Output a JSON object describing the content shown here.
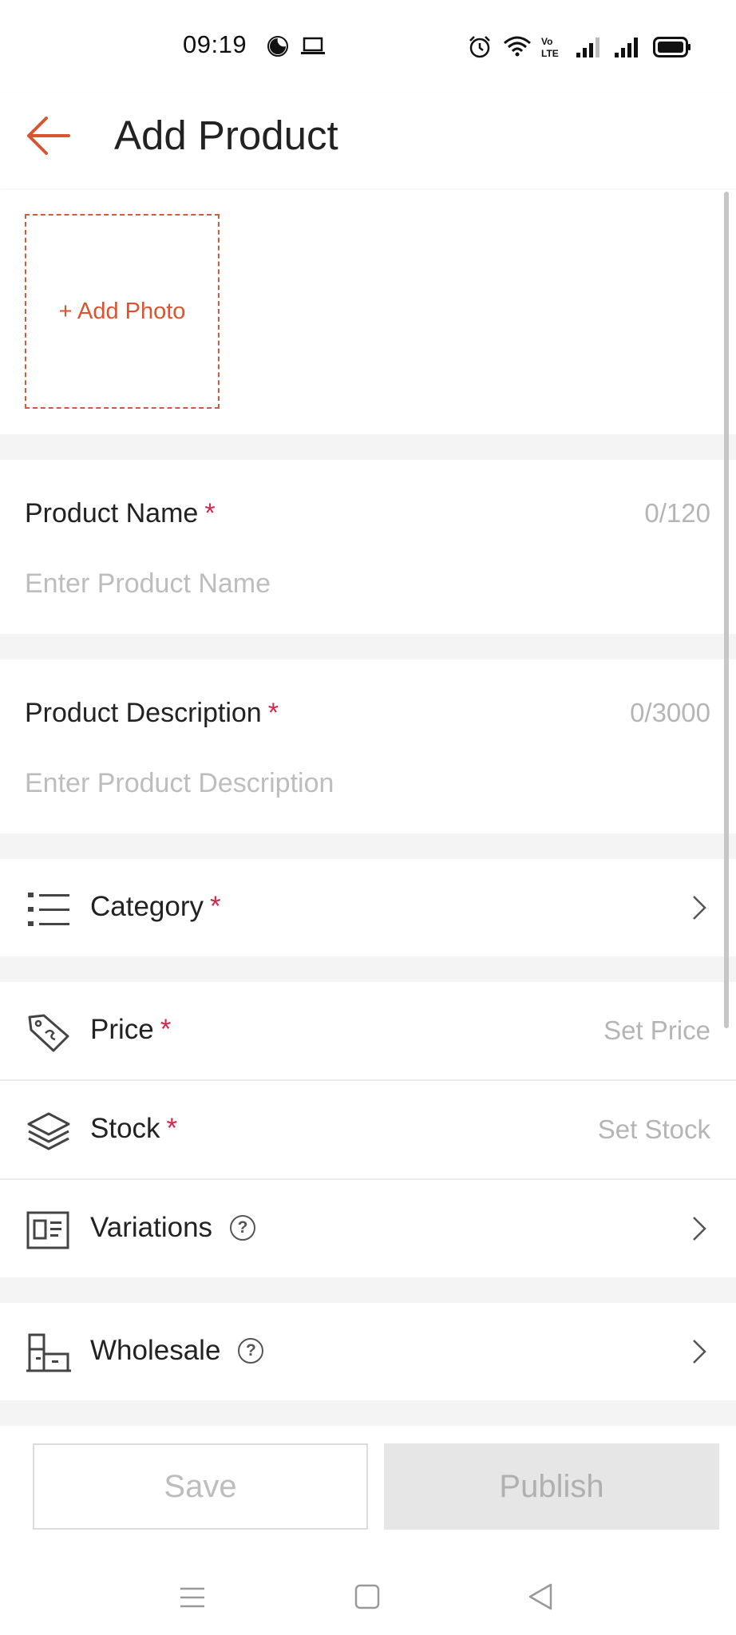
{
  "status_bar": {
    "time": "09:19"
  },
  "header": {
    "title": "Add Product"
  },
  "photo": {
    "add_label": "+ Add Photo"
  },
  "product_name": {
    "label": "Product Name",
    "required_mark": "*",
    "counter": "0/120",
    "placeholder": "Enter Product Name"
  },
  "product_description": {
    "label": "Product Description",
    "required_mark": "*",
    "counter": "0/3000",
    "placeholder": "Enter Product Description"
  },
  "rows": {
    "category": {
      "label": "Category",
      "required_mark": "*"
    },
    "price": {
      "label": "Price",
      "required_mark": "*",
      "value": "Set Price"
    },
    "stock": {
      "label": "Stock",
      "required_mark": "*",
      "value": "Set Stock"
    },
    "variations": {
      "label": "Variations",
      "help": "?"
    },
    "wholesale": {
      "label": "Wholesale",
      "help": "?"
    }
  },
  "actions": {
    "save_label": "Save",
    "publish_label": "Publish"
  },
  "colors": {
    "accent": "#d9552f",
    "required": "#d7264b",
    "placeholder": "#bdbdbd",
    "section_gap": "#f4f4f4"
  },
  "icons": [
    "moon-icon",
    "laptop-icon",
    "alarm-icon",
    "wifi-icon",
    "volte-icon",
    "signal-icon",
    "battery-icon",
    "back-arrow-icon",
    "list-icon",
    "price-tag-icon",
    "layers-icon",
    "variations-icon",
    "wholesale-icon",
    "chevron-right-icon",
    "help-icon",
    "menu-nav-icon",
    "home-nav-icon",
    "back-nav-icon"
  ]
}
